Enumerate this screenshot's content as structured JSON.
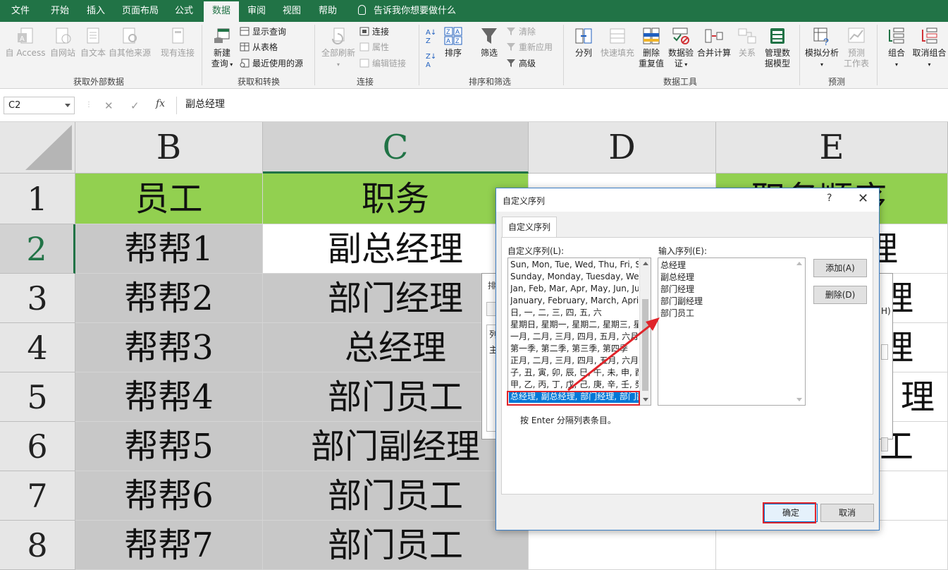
{
  "tabs": [
    "文件",
    "开始",
    "插入",
    "页面布局",
    "公式",
    "数据",
    "审阅",
    "视图",
    "帮助"
  ],
  "active_tab": "数据",
  "tell_me": "告诉我你想要做什么",
  "ribbon": {
    "ext_data": {
      "access": "自 Access",
      "web": "自网站",
      "text": "自文本",
      "other": "自其他来源",
      "existing": "现有连接",
      "label": "获取外部数据"
    },
    "transform": {
      "new_query_1": "新建",
      "new_query_2": "查询",
      "show_queries": "显示查询",
      "from_table": "从表格",
      "recent_sources": "最近使用的源",
      "label": "获取和转换"
    },
    "connections": {
      "refresh_all": "全部刷新",
      "connections": "连接",
      "properties": "属性",
      "edit_links": "编辑链接",
      "label": "连接"
    },
    "sort_filter": {
      "sort": "排序",
      "filter": "筛选",
      "clear": "清除",
      "reapply": "重新应用",
      "advanced": "高级",
      "label": "排序和筛选"
    },
    "data_tools": {
      "split": "分列",
      "flash_fill": "快速填充",
      "remove_dup_1": "删除",
      "remove_dup_2": "重复值",
      "validate_1": "数据验",
      "validate_2": "证",
      "consolidate": "合并计算",
      "relations": "关系",
      "model_1": "管理数",
      "model_2": "据模型",
      "label": "数据工具"
    },
    "forecast": {
      "whatif": "模拟分析",
      "sheet_1": "预测",
      "sheet_2": "工作表",
      "label": "预测"
    },
    "outline": {
      "group": "组合",
      "ungroup": "取消组合"
    }
  },
  "formula_bar": {
    "name_box": "C2",
    "formula": "副总经理"
  },
  "sheet": {
    "columns": [
      "B",
      "C",
      "D",
      "E"
    ],
    "rows": [
      "1",
      "2",
      "3",
      "4",
      "5",
      "6",
      "7",
      "8"
    ],
    "b_col": [
      "员工",
      "帮帮1",
      "帮帮2",
      "帮帮3",
      "帮帮4",
      "帮帮5",
      "帮帮6",
      "帮帮7"
    ],
    "c_col": [
      "职务",
      "副总经理",
      "部门经理",
      "总经理",
      "部门员工",
      "部门副经理",
      "部门员工",
      "部门员工"
    ],
    "e_col": [
      "职务顺序",
      "理",
      "理",
      "理",
      "理",
      "工",
      "",
      ""
    ]
  },
  "sort_dialog": {
    "title": "排",
    "col_label": "列",
    "row_label": "主",
    "h_label": "H)"
  },
  "custom_list_dialog": {
    "title": "自定义序列",
    "help": "?",
    "tab": "自定义序列",
    "lists_label": "自定义序列(L):",
    "entries_label": "输入序列(E):",
    "lists": [
      "Sun, Mon, Tue, Wed, Thu, Fri, Sat",
      "Sunday, Monday, Tuesday, Wednesday",
      "Jan, Feb, Mar, Apr, May, Jun, Jul",
      "January, February, March, April",
      "日, 一, 二, 三, 四, 五, 六",
      "星期日, 星期一, 星期二, 星期三, 星期四",
      "一月, 二月, 三月, 四月, 五月, 六月",
      "第一季, 第二季, 第三季, 第四季",
      "正月, 二月, 三月, 四月, 五月, 六月",
      "子, 丑, 寅, 卯, 辰, 巳, 午, 未, 申, 酉",
      "甲, 乙, 丙, 丁, 戊, 己, 庚, 辛, 壬, 癸",
      "总经理, 副总经理, 部门经理, 部门副经理"
    ],
    "entries": [
      "总经理",
      "副总经理",
      "部门经理",
      "部门副经理",
      "部门员工"
    ],
    "add": "添加(A)",
    "delete": "删除(D)",
    "hint": "按 Enter 分隔列表条目。",
    "ok": "确定",
    "cancel": "取消"
  },
  "colors": {
    "excel_green": "#217346",
    "header_green": "#92d050",
    "selection_blue": "#0078d7",
    "annotation_red": "#e0242a"
  }
}
